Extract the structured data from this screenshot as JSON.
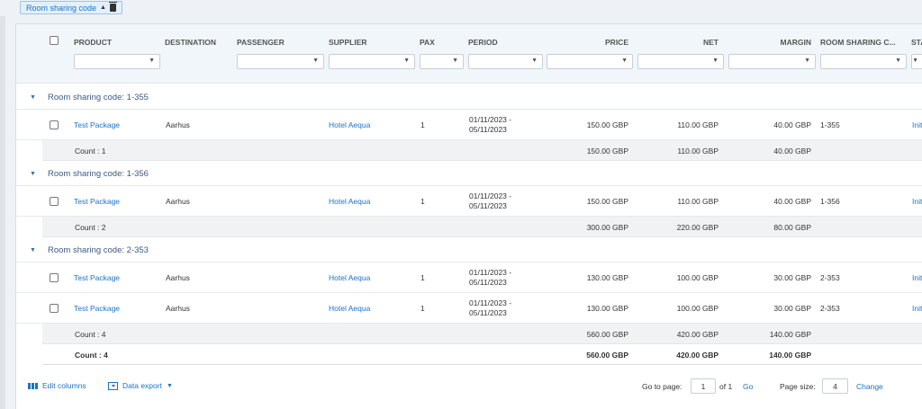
{
  "group_chip": {
    "label": "Room sharing code"
  },
  "columns": {
    "product": "PRODUCT",
    "destination": "DESTINATION",
    "passenger": "PASSENGER",
    "supplier": "SUPPLIER",
    "pax": "PAX",
    "period": "PERIOD",
    "price": "PRICE",
    "net": "NET",
    "margin": "MARGIN",
    "room_sharing_code": "ROOM SHARING C...",
    "status": "STA"
  },
  "groups": [
    {
      "label": "Room sharing code: 1-355",
      "rows": [
        {
          "product": "Test Package",
          "destination": "Aarhus",
          "supplier": "Hotel Aequa",
          "pax": "1",
          "period_start": "01/11/2023 -",
          "period_end": "05/11/2023",
          "price": "150.00 GBP",
          "net": "110.00 GBP",
          "margin": "40.00 GBP",
          "code": "1-355",
          "status": "Init"
        }
      ],
      "summary": {
        "count": "Count : 1",
        "price": "150.00 GBP",
        "net": "110.00 GBP",
        "margin": "40.00 GBP"
      }
    },
    {
      "label": "Room sharing code: 1-356",
      "rows": [
        {
          "product": "Test Package",
          "destination": "Aarhus",
          "supplier": "Hotel Aequa",
          "pax": "1",
          "period_start": "01/11/2023 -",
          "period_end": "05/11/2023",
          "price": "150.00 GBP",
          "net": "110.00 GBP",
          "margin": "40.00 GBP",
          "code": "1-356",
          "status": "Init"
        }
      ],
      "summary": {
        "count": "Count : 2",
        "price": "300.00 GBP",
        "net": "220.00 GBP",
        "margin": "80.00 GBP"
      }
    },
    {
      "label": "Room sharing code: 2-353",
      "rows": [
        {
          "product": "Test Package",
          "destination": "Aarhus",
          "supplier": "Hotel Aequa",
          "pax": "1",
          "period_start": "01/11/2023 -",
          "period_end": "05/11/2023",
          "price": "130.00 GBP",
          "net": "100.00 GBP",
          "margin": "30.00 GBP",
          "code": "2-353",
          "status": "Init"
        },
        {
          "product": "Test Package",
          "destination": "Aarhus",
          "supplier": "Hotel Aequa",
          "pax": "1",
          "period_start": "01/11/2023 -",
          "period_end": "05/11/2023",
          "price": "130.00 GBP",
          "net": "100.00 GBP",
          "margin": "30.00 GBP",
          "code": "2-353",
          "status": "Init"
        }
      ],
      "summary": {
        "count": "Count : 4",
        "price": "560.00 GBP",
        "net": "420.00 GBP",
        "margin": "140.00 GBP"
      }
    }
  ],
  "total": {
    "count": "Count : 4",
    "price": "560.00 GBP",
    "net": "420.00 GBP",
    "margin": "140.00 GBP"
  },
  "footer": {
    "edit_columns": "Edit columns",
    "data_export": "Data export",
    "go_to_page_label": "Go to page:",
    "page_value": "1",
    "of_pages": "of 1",
    "go": "Go",
    "page_size_label": "Page size:",
    "page_size_value": "4",
    "change": "Change"
  },
  "colors": {
    "accent": "#1a73c9",
    "header_bg": "#f1f6fb",
    "summary_bg": "#f0f2f4"
  }
}
